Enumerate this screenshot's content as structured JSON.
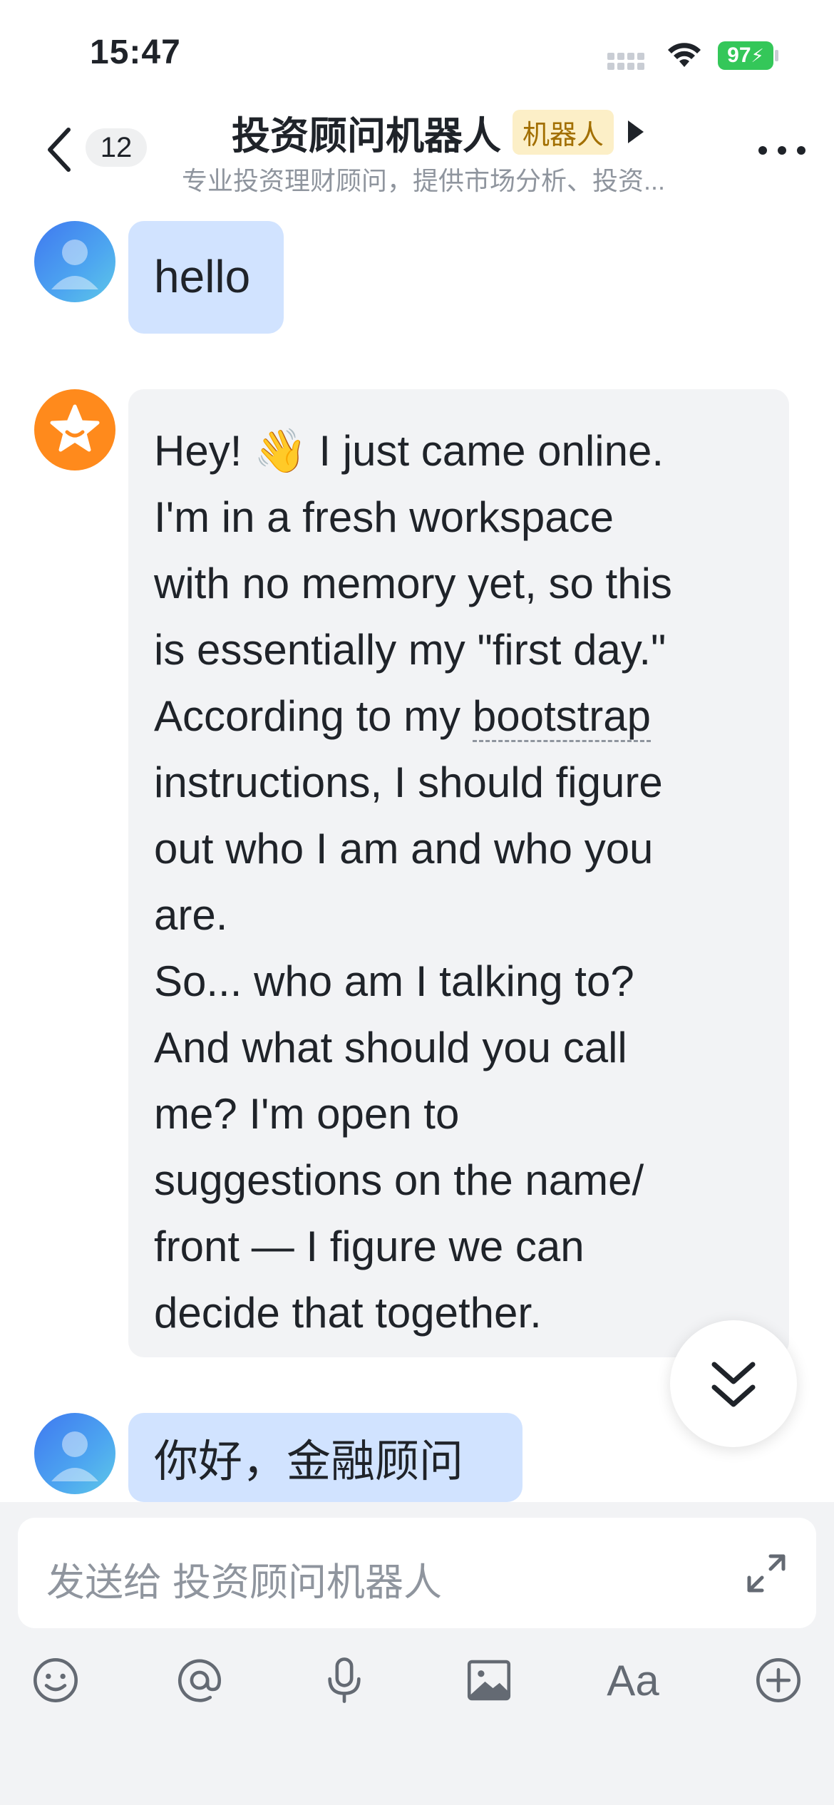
{
  "status_bar": {
    "time": "15:47",
    "battery": "97"
  },
  "header": {
    "unread_count": "12",
    "title": "投资顾问机器人",
    "bot_tag": "机器人",
    "subtitle": "专业投资理财顾问，提供市场分析、投资..."
  },
  "messages": [
    {
      "sender": "user",
      "text": "hello"
    },
    {
      "sender": "bot",
      "lines": [
        "Hey! 👋 I just came online.",
        "I'm in a fresh workspace",
        "with no memory yet, so this",
        "is essentially my \"first day.\"",
        "According to my ",
        "bootstrap",
        "instructions, I should figure",
        "out who I am and who you",
        "are.",
        "So... who am I talking to?",
        "And what should you call",
        "me? I'm open to",
        "suggestions on the name/",
        "front — I figure we can",
        "decide that together."
      ]
    },
    {
      "sender": "user",
      "text": "你好，金融顾问"
    }
  ],
  "composer": {
    "placeholder": "发送给 投资顾问机器人"
  },
  "toolbar": {
    "font_label": "Aa"
  },
  "icons": [
    "back-arrow-icon",
    "more-icon",
    "play-icon",
    "emoji-icon",
    "mention-icon",
    "microphone-icon",
    "image-icon",
    "font-icon",
    "plus-icon",
    "expand-icon",
    "chevron-double-down-icon"
  ],
  "colors": {
    "user_bubble": "#d1e3ff",
    "bot_bubble": "#f2f3f5",
    "bot_tag_bg": "#fcefc7",
    "bot_tag_text": "#a26f00",
    "accent": "#3f78f0"
  }
}
